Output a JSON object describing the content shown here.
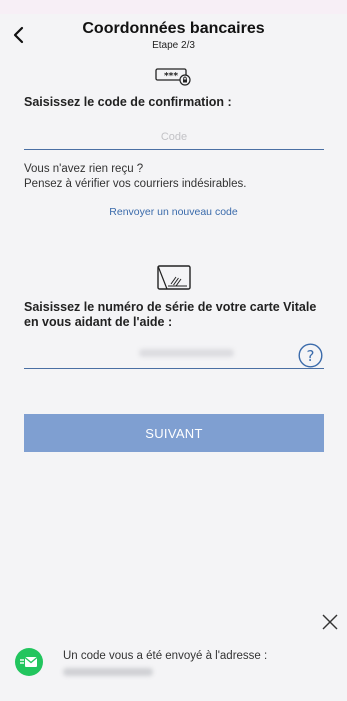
{
  "header": {
    "title": "Coordonnées bancaires",
    "step": "Etape 2/3"
  },
  "confirmation": {
    "label": "Saisissez le code de confirmation :",
    "code_placeholder": "Code",
    "info_line1": "Vous n'avez rien reçu ?",
    "info_line2": "Pensez à vérifier vos courriers indésirables.",
    "resend_link": "Renvoyer un nouveau code"
  },
  "vitale": {
    "label_line1": "Saisissez le numéro de série de votre carte Vitale",
    "label_line2": "en vous aidant de l'aide :"
  },
  "actions": {
    "next_label": "SUIVANT"
  },
  "notification": {
    "message": "Un code vous a été envoyé à l'adresse :"
  },
  "colors": {
    "accent": "#7f9fd1",
    "link": "#3b6bab",
    "success": "#22c55e"
  }
}
